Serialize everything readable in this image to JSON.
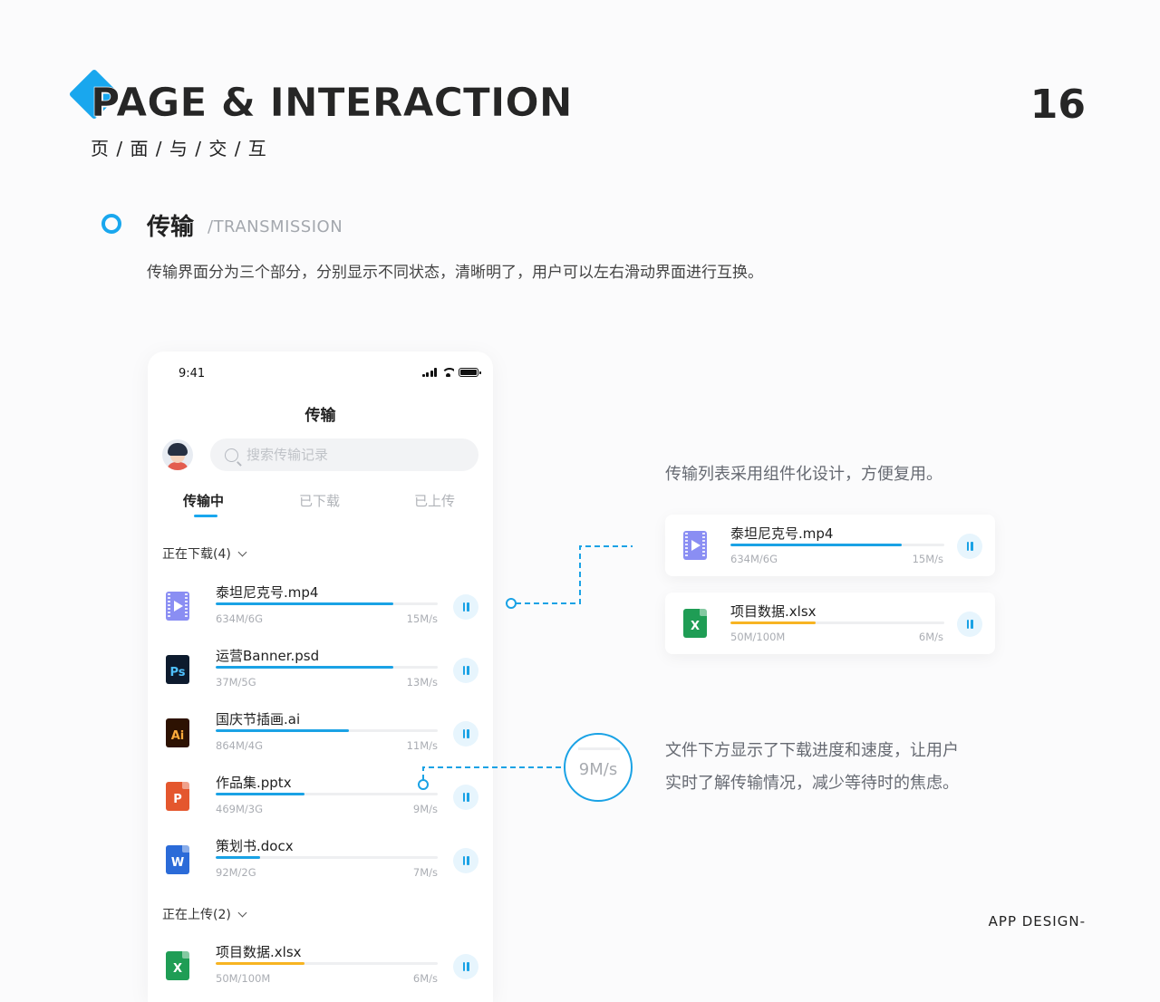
{
  "header": {
    "title": "PAGE & INTERACTION",
    "subtitle": "页 / 面 / 与 / 交 / 互",
    "page_number": "16",
    "footer": "APP DESIGN-"
  },
  "section": {
    "title": "传输",
    "subtitle": "/TRANSMISSION",
    "description": "传输界面分为三个部分，分别显示不同状态，清晰明了，用户可以左右滑动界面进行互换。"
  },
  "phone": {
    "status_time": "9:41",
    "nav_title": "传输",
    "search_placeholder": "搜索传输记录",
    "tabs": [
      {
        "label": "传输中",
        "active": true
      },
      {
        "label": "已下载",
        "active": false
      },
      {
        "label": "已上传",
        "active": false
      }
    ],
    "downloading_header": "正在下载(4)",
    "downloads": [
      {
        "name": "泰坦尼克号.mp4",
        "size": "634M/6G",
        "speed": "15M/s",
        "progress": 0.8,
        "type": "video"
      },
      {
        "name": "运营Banner.psd",
        "size": "37M/5G",
        "speed": "13M/s",
        "progress": 0.8,
        "type": "psd",
        "icon_text": "Ps"
      },
      {
        "name": "国庆节插画.ai",
        "size": "864M/4G",
        "speed": "11M/s",
        "progress": 0.6,
        "type": "ai",
        "icon_text": "Ai"
      },
      {
        "name": "作品集.pptx",
        "size": "469M/3G",
        "speed": "9M/s",
        "progress": 0.4,
        "type": "ppt",
        "icon_text": "P"
      },
      {
        "name": "策划书.docx",
        "size": "92M/2G",
        "speed": "7M/s",
        "progress": 0.2,
        "type": "word",
        "icon_text": "W"
      }
    ],
    "uploading_header": "正在上传(2)",
    "uploads": [
      {
        "name": "项目数据.xlsx",
        "size": "50M/100M",
        "speed": "6M/s",
        "progress": 0.4,
        "type": "xls",
        "icon_text": "X",
        "color": "#f7b422"
      }
    ]
  },
  "annotations": {
    "note1": "传输列表采用组件化设计，方便复用。",
    "cards": [
      {
        "name": "泰坦尼克号.mp4",
        "size": "634M/6G",
        "speed": "15M/s",
        "progress": 0.8,
        "type": "video"
      },
      {
        "name": "项目数据.xlsx",
        "size": "50M/100M",
        "speed": "6M/s",
        "progress": 0.4,
        "type": "xls",
        "icon_text": "X",
        "color": "#f7b422"
      }
    ],
    "zoom_speed": "9M/s",
    "note2_line1": "文件下方显示了下载进度和速度，让用户",
    "note2_line2": "实时了解传输情况，减少等待时的焦虑。"
  },
  "colors": {
    "accent": "#19a7ee",
    "progress_blue": "#1aa2e5",
    "progress_orange": "#f7b422"
  }
}
